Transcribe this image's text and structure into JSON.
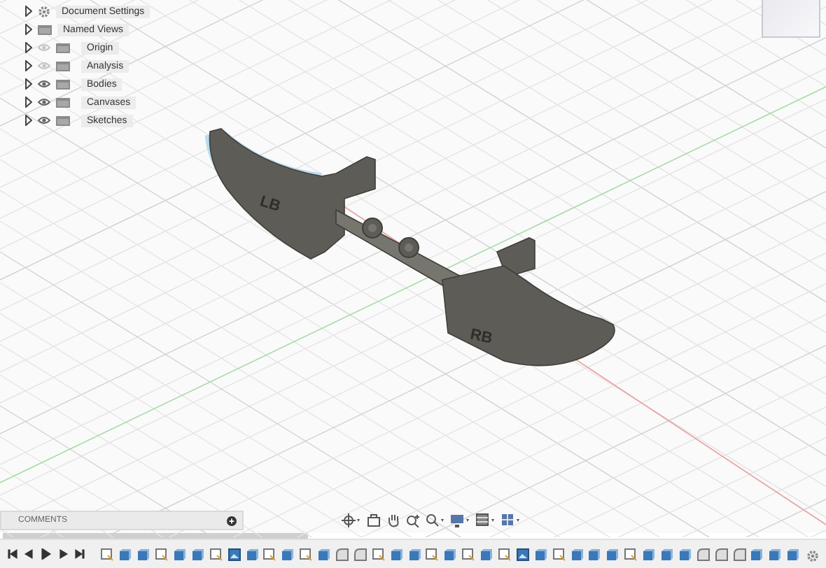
{
  "browser": {
    "items": [
      {
        "label": "Document Settings",
        "kind": "settings"
      },
      {
        "label": "Named Views",
        "kind": "views"
      },
      {
        "label": "Origin",
        "kind": "folder",
        "visible": false
      },
      {
        "label": "Analysis",
        "kind": "folder",
        "visible": false
      },
      {
        "label": "Bodies",
        "kind": "folder",
        "visible": true
      },
      {
        "label": "Canvases",
        "kind": "folder",
        "visible": true
      },
      {
        "label": "Sketches",
        "kind": "folder",
        "visible": true
      }
    ]
  },
  "model": {
    "labels": [
      "LB",
      "RB"
    ]
  },
  "comments": {
    "title": "COMMENTS"
  },
  "timeline": {
    "features": [
      {
        "kind": "sketch"
      },
      {
        "kind": "body"
      },
      {
        "kind": "body"
      },
      {
        "kind": "sketch"
      },
      {
        "kind": "body"
      },
      {
        "kind": "body"
      },
      {
        "kind": "sketch"
      },
      {
        "kind": "canvas"
      },
      {
        "kind": "body"
      },
      {
        "kind": "sketch"
      },
      {
        "kind": "body"
      },
      {
        "kind": "sketch"
      },
      {
        "kind": "body"
      },
      {
        "kind": "fillet"
      },
      {
        "kind": "fillet"
      },
      {
        "kind": "sketch"
      },
      {
        "kind": "body"
      },
      {
        "kind": "body"
      },
      {
        "kind": "sketch"
      },
      {
        "kind": "body"
      },
      {
        "kind": "sketch"
      },
      {
        "kind": "body"
      },
      {
        "kind": "sketch"
      },
      {
        "kind": "canvas"
      },
      {
        "kind": "body"
      },
      {
        "kind": "sketch"
      },
      {
        "kind": "body"
      },
      {
        "kind": "body"
      },
      {
        "kind": "body"
      },
      {
        "kind": "sketch"
      },
      {
        "kind": "body"
      },
      {
        "kind": "body"
      },
      {
        "kind": "body"
      },
      {
        "kind": "fillet"
      },
      {
        "kind": "fillet"
      },
      {
        "kind": "fillet"
      },
      {
        "kind": "body"
      },
      {
        "kind": "body"
      },
      {
        "kind": "body"
      }
    ]
  }
}
